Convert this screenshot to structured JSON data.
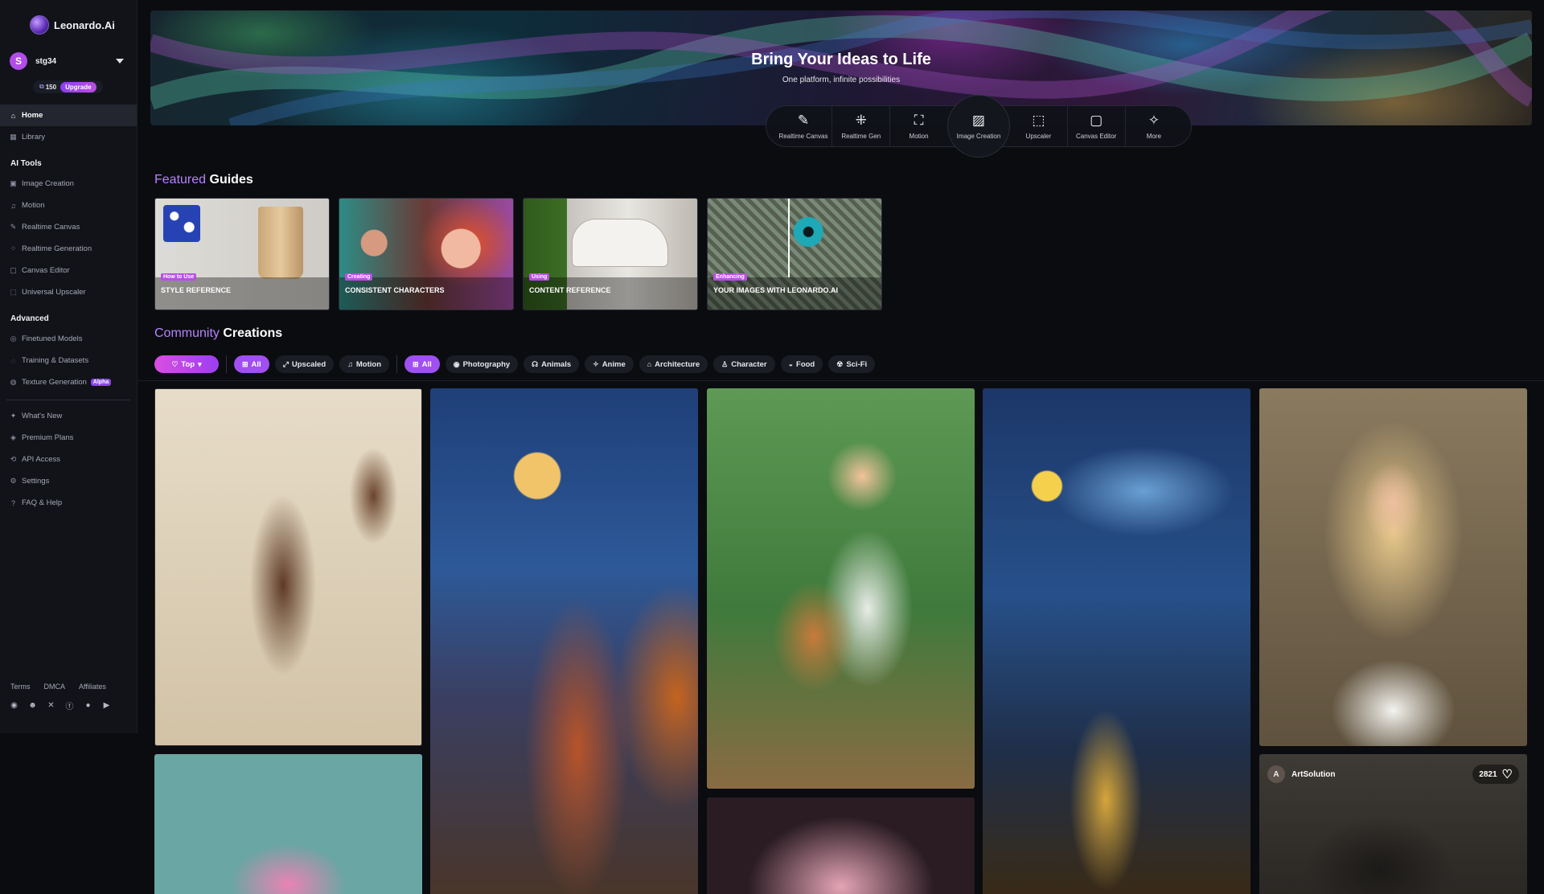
{
  "brand": {
    "name": "Leonardo.Ai"
  },
  "user": {
    "initial": "S",
    "name": "stg34",
    "tokens": "150",
    "upgrade_label": "Upgrade"
  },
  "sidebar": {
    "main_items": [
      {
        "label": "Home",
        "icon": "home-icon"
      },
      {
        "label": "Library",
        "icon": "library-icon"
      }
    ],
    "ai_tools_title": "AI Tools",
    "ai_tools": [
      {
        "label": "Image Creation",
        "icon": "image-icon"
      },
      {
        "label": "Motion",
        "icon": "motion-icon"
      },
      {
        "label": "Realtime Canvas",
        "icon": "brush-icon"
      },
      {
        "label": "Realtime Generation",
        "icon": "grid-icon"
      },
      {
        "label": "Canvas Editor",
        "icon": "canvas-icon"
      },
      {
        "label": "Universal Upscaler",
        "icon": "upscale-icon"
      }
    ],
    "advanced_title": "Advanced",
    "advanced": [
      {
        "label": "Finetuned Models",
        "icon": "model-icon"
      },
      {
        "label": "Training & Datasets",
        "icon": "dataset-icon"
      },
      {
        "label": "Texture Generation",
        "icon": "texture-icon",
        "badge": "Alpha"
      }
    ],
    "secondary": [
      {
        "label": "What's New",
        "icon": "megaphone-icon"
      },
      {
        "label": "Premium Plans",
        "icon": "premium-icon"
      },
      {
        "label": "API Access",
        "icon": "api-icon"
      },
      {
        "label": "Settings",
        "icon": "gear-icon"
      },
      {
        "label": "FAQ & Help",
        "icon": "help-icon"
      }
    ],
    "footer_links": [
      "Terms",
      "DMCA",
      "Affiliates"
    ],
    "social_icons": [
      "discord-icon",
      "reddit-icon",
      "x-icon",
      "facebook-icon",
      "apple-icon",
      "play-store-icon"
    ]
  },
  "hero": {
    "title": "Bring Your Ideas to Life",
    "subtitle": "One platform, infinite possibilities",
    "tools": [
      {
        "label": "Realtime Canvas",
        "icon": "brush-icon"
      },
      {
        "label": "Realtime Gen",
        "icon": "grid-icon"
      },
      {
        "label": "Motion",
        "icon": "motion-icon"
      },
      {
        "label": "Image Creation",
        "icon": "image-icon",
        "active": true
      },
      {
        "label": "Upscaler",
        "icon": "upscale-icon"
      },
      {
        "label": "Canvas Editor",
        "icon": "canvas-icon"
      },
      {
        "label": "More",
        "icon": "sparkle-icon"
      }
    ]
  },
  "featured": {
    "accent": "Featured",
    "title": "Guides",
    "guides": [
      {
        "badge": "How to Use",
        "title": "STYLE REFERENCE"
      },
      {
        "badge": "Creating",
        "title": "CONSISTENT CHARACTERS"
      },
      {
        "badge": "Using",
        "title": "CONTENT REFERENCE"
      },
      {
        "badge": "Enhancing",
        "title": "YOUR IMAGES WITH LEONARDO.AI"
      }
    ]
  },
  "community": {
    "accent": "Community",
    "title": "Creations",
    "sort_label": "Top",
    "type_filters": [
      "All",
      "Upscaled",
      "Motion"
    ],
    "category_filters": [
      "All",
      "Photography",
      "Animals",
      "Anime",
      "Architecture",
      "Character",
      "Food",
      "Sci-Fi"
    ],
    "featured_card": {
      "initial": "A",
      "username": "ArtSolution",
      "likes": "2821"
    }
  },
  "colors": {
    "accent_purple": "#b682ff",
    "chip_pink": "#d84fe0",
    "background": "#0b0c10",
    "sidebar": "#111319"
  }
}
